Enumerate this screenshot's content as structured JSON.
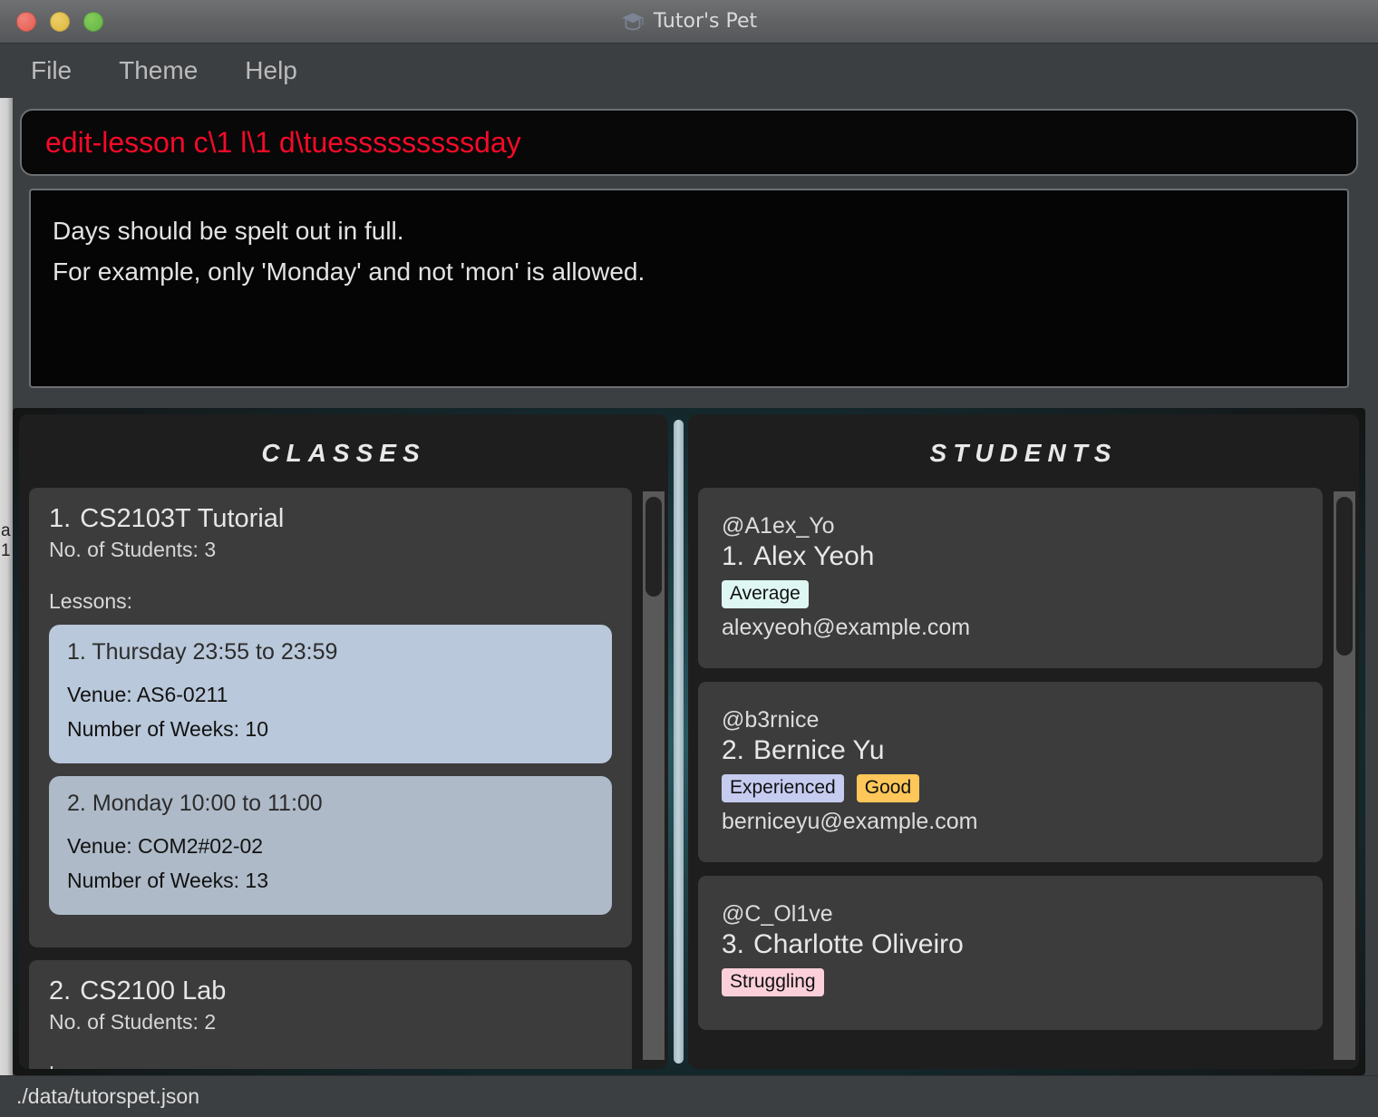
{
  "window": {
    "title": "Tutor's Pet",
    "title_icon": "graduation-cap-icon",
    "traffic_lights": {
      "close_color": "#e4594e",
      "minimize_color": "#dfb63f",
      "maximize_color": "#63b441"
    }
  },
  "menubar": {
    "items": [
      {
        "label": "File"
      },
      {
        "label": "Theme"
      },
      {
        "label": "Help"
      }
    ]
  },
  "command_box": {
    "value": "edit-lesson c\\1 l\\1 d\\tuesssssssssday",
    "text_color": "#f50a28"
  },
  "result_box": {
    "lines": [
      "Days should be spelt out in full.",
      "For example, only 'Monday' and not 'mon' is allowed."
    ]
  },
  "classes_pane": {
    "title": "CLASSES",
    "cards": [
      {
        "index": "1.",
        "name": "CS2103T Tutorial",
        "students_label": "No. of Students:",
        "students_count": "3",
        "lessons_label": "Lessons:",
        "lessons": [
          {
            "index": "1.",
            "schedule": "Thursday 23:55 to 23:59",
            "venue_label": "Venue:",
            "venue": "AS6-0211",
            "weeks_label": "Number of Weeks:",
            "weeks": "10"
          },
          {
            "index": "2.",
            "schedule": "Monday 10:00 to 11:00",
            "venue_label": "Venue:",
            "venue": "COM2#02-02",
            "weeks_label": "Number of Weeks:",
            "weeks": "13"
          }
        ]
      },
      {
        "index": "2.",
        "name": "CS2100 Lab",
        "students_label": "No. of Students:",
        "students_count": "2",
        "lessons_label": "Lessons:",
        "lessons": []
      }
    ]
  },
  "students_pane": {
    "title": "STUDENTS",
    "cards": [
      {
        "handle": "@A1ex_Yo",
        "index": "1.",
        "name": "Alex Yeoh",
        "tags": [
          {
            "label": "Average",
            "color": "#dff7f2"
          }
        ],
        "email": "alexyeoh@example.com"
      },
      {
        "handle": "@b3rnice",
        "index": "2.",
        "name": "Bernice Yu",
        "tags": [
          {
            "label": "Experienced",
            "color": "#c6cbf0"
          },
          {
            "label": "Good",
            "color": "#fdc martin"
          }
        ],
        "email": "berniceyu@example.com"
      },
      {
        "handle": "@C_Ol1ve",
        "index": "3.",
        "name": "Charlotte Oliveiro",
        "tags": [
          {
            "label": "Struggling",
            "color": "#fbd0da"
          }
        ],
        "email": ""
      }
    ]
  },
  "statusbar": {
    "path": "./data/tutorspet.json"
  },
  "background_window": {
    "sliver_text": "a 1"
  }
}
